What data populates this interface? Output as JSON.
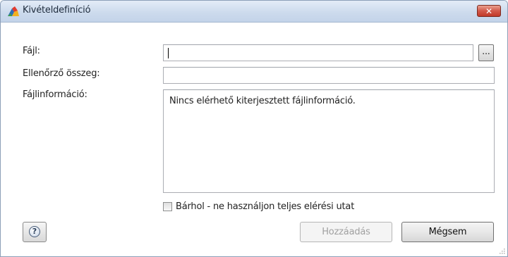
{
  "window": {
    "title": "Kivételdefiníció",
    "close_label": "✕",
    "icon": "avg-logo-icon"
  },
  "form": {
    "file_label": "Fájl:",
    "file_value": "",
    "browse_label": "...",
    "checksum_label": "Ellenőrző összeg:",
    "checksum_value": "",
    "fileinfo_label": "Fájlinformáció:",
    "fileinfo_text": "Nincs elérhető kiterjesztett fájlinformáció."
  },
  "options": {
    "anywhere_label": "Bárhol - ne használjon teljes elérési utat",
    "anywhere_checked": false
  },
  "buttons": {
    "help_icon": "help-icon",
    "help_glyph": "?",
    "add_label": "Hozzáadás",
    "add_enabled": false,
    "cancel_label": "Mégsem"
  },
  "colors": {
    "titlebar": "#cddbed",
    "close_button": "#c13a29",
    "disabled_text": "#a0a0a0"
  }
}
